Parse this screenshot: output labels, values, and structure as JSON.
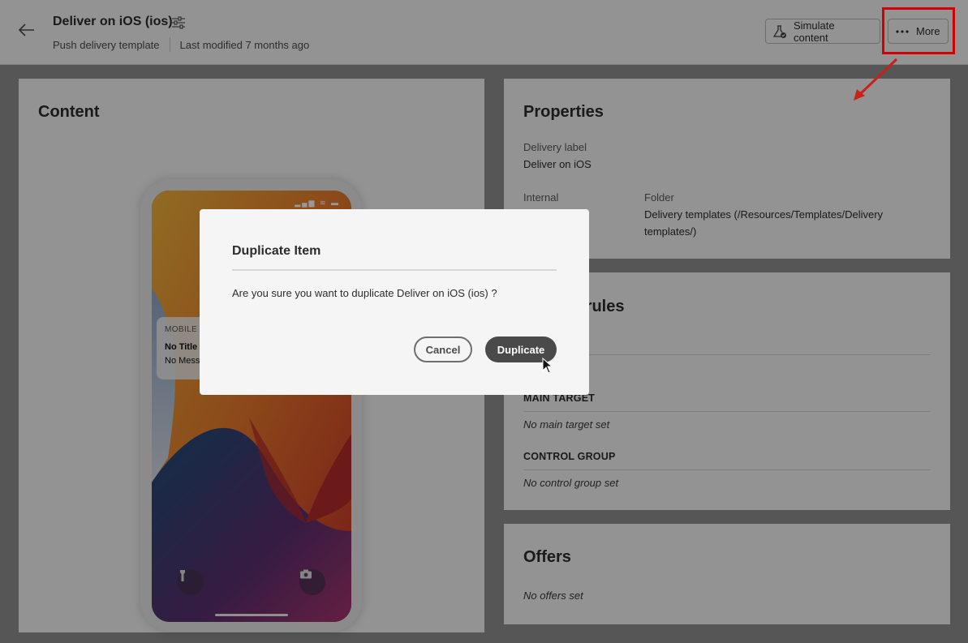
{
  "header": {
    "title": "Deliver on iOS (ios)",
    "subtitle_type": "Push delivery template",
    "subtitle_modified": "Last modified 7 months ago",
    "simulate_label": "Simulate content",
    "more_label": "More"
  },
  "content_panel": {
    "title": "Content",
    "notification": {
      "app": "MOBILE A",
      "title": "No Title",
      "message": "No Mess"
    }
  },
  "properties": {
    "title": "Properties",
    "delivery_label_label": "Delivery label",
    "delivery_label_value": "Deliver on iOS",
    "internal_label": "Internal",
    "folder_label": "Folder",
    "folder_value": "Delivery templates (/Resources/Templates/Delivery templates/)"
  },
  "rules": {
    "title_partial": "e rules",
    "main_target_label": "MAIN TARGET",
    "main_target_value": "No main target set",
    "control_group_label": "CONTROL GROUP",
    "control_group_value": "No control group set"
  },
  "offers": {
    "title": "Offers",
    "value": "No offers set"
  },
  "dialog": {
    "title": "Duplicate Item",
    "message": "Are you sure you want to duplicate Deliver on iOS (ios) ?",
    "cancel_label": "Cancel",
    "duplicate_label": "Duplicate"
  },
  "colors": {
    "annotation": "#d40000",
    "primary_button": "#4a4a4a"
  }
}
